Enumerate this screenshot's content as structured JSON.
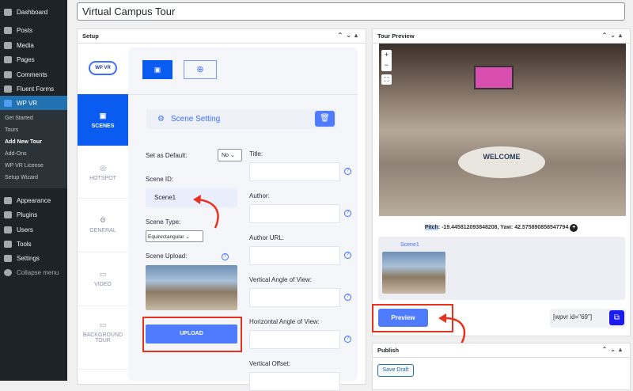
{
  "sidebar": {
    "items": [
      {
        "label": "Dashboard"
      },
      {
        "label": "Posts"
      },
      {
        "label": "Media"
      },
      {
        "label": "Pages"
      },
      {
        "label": "Comments"
      },
      {
        "label": "Fluent Forms"
      },
      {
        "label": "WP VR"
      },
      {
        "label": "Appearance"
      },
      {
        "label": "Plugins"
      },
      {
        "label": "Users"
      },
      {
        "label": "Tools"
      },
      {
        "label": "Settings"
      },
      {
        "label": "Collapse menu"
      }
    ],
    "submenu": [
      {
        "label": "Get Started"
      },
      {
        "label": "Tours"
      },
      {
        "label": "Add New Tour"
      },
      {
        "label": "Add-Ons"
      },
      {
        "label": "WP VR License"
      },
      {
        "label": "Setup Wizard"
      }
    ]
  },
  "title": "Virtual Campus Tour",
  "setup": {
    "header": "Setup",
    "logo": "WP VR",
    "tabs": [
      {
        "label": "SCENES"
      },
      {
        "label": "HOTSPOT"
      },
      {
        "label": "GENERAL"
      },
      {
        "label": "VIDEO"
      },
      {
        "label": "BACKGROUND TOUR"
      }
    ],
    "scene_setting": "Scene Setting",
    "set_default_label": "Set as Default:",
    "set_default_value": "No",
    "scene_id_label": "Scene ID:",
    "scene_id_value": "Scene1",
    "scene_type_label": "Scene Type:",
    "scene_type_value": "Equirectangular",
    "scene_upload_label": "Scene Upload:",
    "upload_button": "UPLOAD",
    "right_fields": [
      "Title:",
      "Author:",
      "Author URL:",
      "Vertical Angle of View:",
      "Horizontal Angle of View:",
      "Vertical Offset:"
    ]
  },
  "preview": {
    "header": "Tour Preview",
    "pitch_label": "Pitch",
    "pitch_rest": ": -19.445812093848208, Yaw: 42.575890858547794",
    "scene_name": "Scene1",
    "preview_button": "Preview",
    "shortcode": "[wpvr id=\"69\"]",
    "welcome": "WELCOME"
  },
  "publish": {
    "header": "Publish",
    "save_draft": "Save Draft"
  },
  "colors": {
    "accent": "#0a5bf0",
    "button": "#4f7cff",
    "annotation": "#e6321e"
  }
}
